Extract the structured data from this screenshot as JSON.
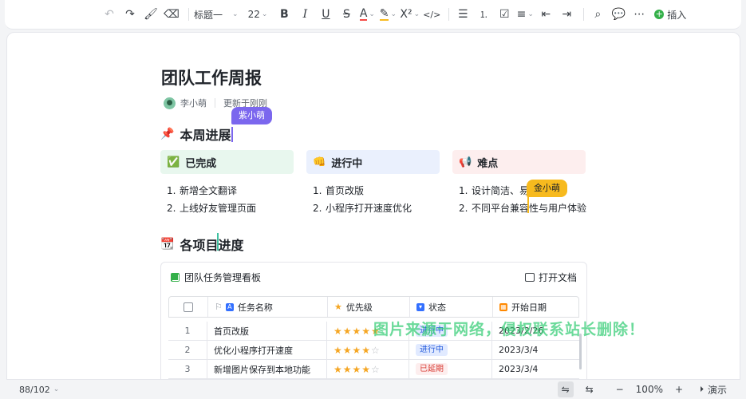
{
  "toolbar": {
    "heading_select": "标题一",
    "font_size": "22",
    "insert_label": "插入"
  },
  "doc": {
    "title": "团队工作周报",
    "author": "李小萌",
    "updated": "更新于刚刚",
    "cursors": [
      {
        "name": "紫小萌",
        "color": "#7b67ee"
      },
      {
        "name": "金小萌",
        "color": "#f7ba1e"
      }
    ],
    "section1": {
      "emoji": "📌",
      "title": "本周进展"
    },
    "section2": {
      "emoji": "📆",
      "title": "各项目进度"
    },
    "columns": [
      {
        "emoji": "✅",
        "title": "已完成",
        "bg": "#e8f7ee",
        "items": [
          "新增全文翻译",
          "上线好友管理页面"
        ]
      },
      {
        "emoji": "👊",
        "title": "进行中",
        "bg": "#eaf0fd",
        "items": [
          "首页改版",
          "小程序打开速度优化"
        ]
      },
      {
        "emoji": "📢",
        "title": "难点",
        "bg": "#fdeeee",
        "items": [
          "设计简洁、易",
          "不同平台兼容性与用户体验"
        ]
      }
    ]
  },
  "kanban": {
    "title": "团队任务管理看板",
    "open_doc": "打开文档",
    "columns": [
      "任务名称",
      "优先级",
      "状态",
      "开始日期"
    ],
    "rows": [
      {
        "num": "1",
        "task": "首页改版",
        "stars": 5,
        "status": "进行中",
        "date": "2023/2/26"
      },
      {
        "num": "2",
        "task": "优化小程序打开速度",
        "stars": 4,
        "status": "进行中",
        "date": "2023/3/4"
      },
      {
        "num": "3",
        "task": "新增图片保存到本地功能",
        "stars": 4,
        "status": "已延期",
        "date": "2023/3/4"
      }
    ]
  },
  "watermark": "图片来源于网络，侵权联系站长删除！",
  "statusbar": {
    "page_count": "88/102",
    "zoom": "100%",
    "present_label": "演示"
  }
}
